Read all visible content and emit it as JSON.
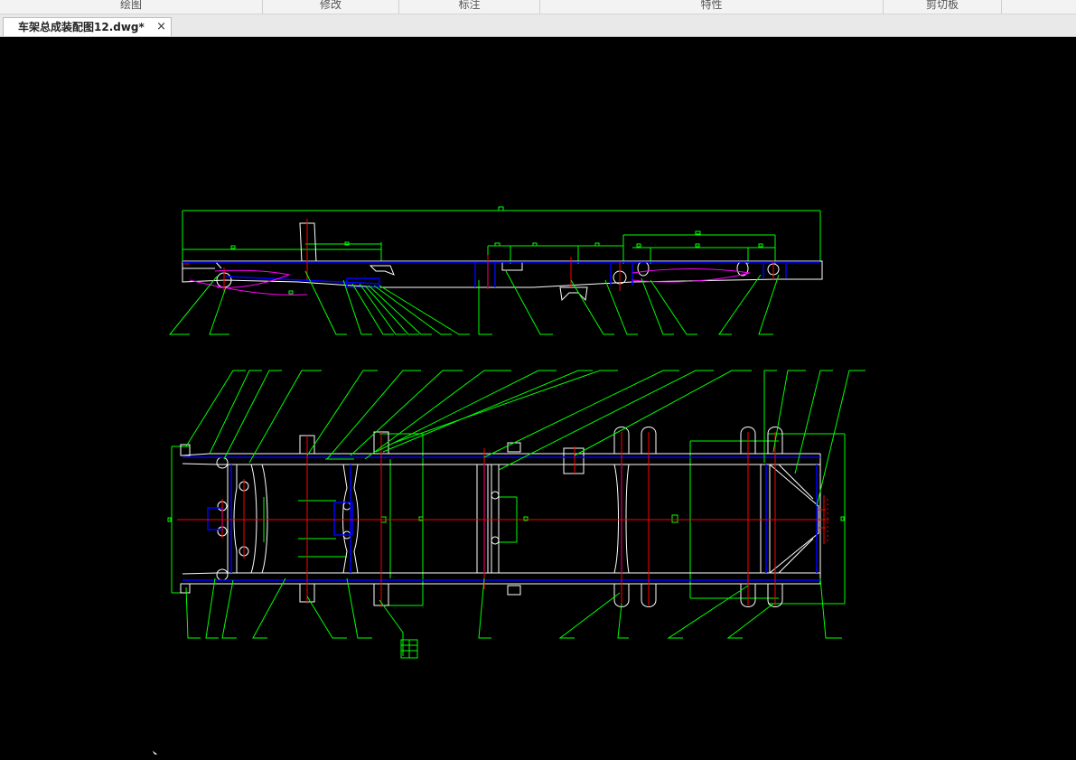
{
  "ribbon": {
    "groups": [
      "绘图",
      "修改",
      "标注",
      "特性",
      "剪切板"
    ]
  },
  "document_tab": {
    "title": "车架总成装配图12.dwg*",
    "close_label": "×"
  },
  "colors": {
    "background": "#000000",
    "dimension": "#00ff00",
    "outline": "#ffffff",
    "hidden": "#0000ff",
    "centerline": "#ff0000",
    "spline": "#ff00ff"
  },
  "icons": [
    "close-icon",
    "mouse-cursor-icon"
  ]
}
